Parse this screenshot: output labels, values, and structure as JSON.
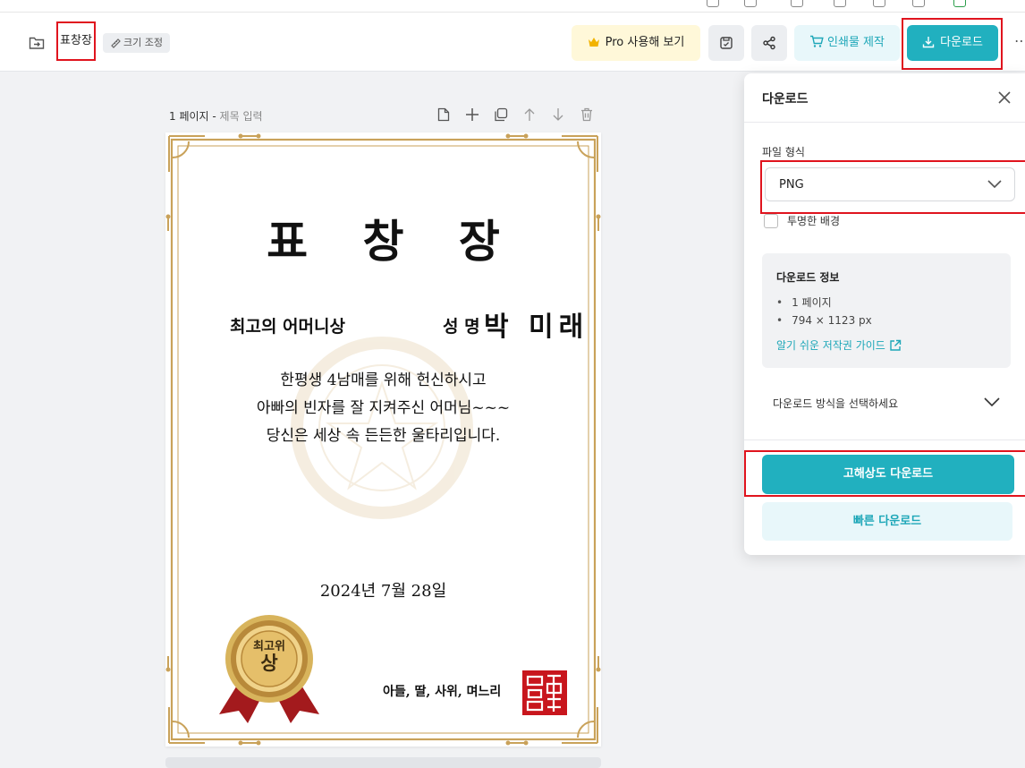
{
  "topbar": {
    "doc_title": "표창장",
    "resize_label": "크기 조정",
    "pro_label": "Pro 사용해 보기",
    "print_label": "인쇄물 제작",
    "download_label": "다운로드",
    "more_label": "⋯"
  },
  "page": {
    "number_label": "1 페이지",
    "separator": " - ",
    "title_placeholder": "제목 입력"
  },
  "certificate": {
    "title": "표 창 장",
    "award": "최고의 어머니상",
    "name_label": "성 명",
    "name": "박 미래",
    "body_lines": [
      "한평생 4남매를 위해 헌신하시고",
      "아빠의 빈자를 잘 지켜주신 어머님~~~",
      "당신은 세상 속 든든한 울타리입니다."
    ],
    "date": "2024년 7월 28일",
    "from": "아들, 딸, 사위, 며느리",
    "medal_top": "최고위",
    "medal_bottom": "상"
  },
  "panel": {
    "title": "다운로드",
    "format_label": "파일 형식",
    "format_value": "PNG",
    "transparent_label": "투명한 배경",
    "info_title": "다운로드 정보",
    "info_items": [
      "1 페이지",
      "794 × 1123 px"
    ],
    "copyright_link": "알기 쉬운 저작권 가이드",
    "method_label": "다운로드 방식을 선택하세요",
    "hq_button": "고해상도 다운로드",
    "fast_button": "빠른 다운로드"
  },
  "colors": {
    "accent": "#21b0bf",
    "accent_light": "#e8f7fa",
    "highlight": "#e0141e",
    "pro_bg": "#fff8d9",
    "gold": "#c9a25a"
  }
}
